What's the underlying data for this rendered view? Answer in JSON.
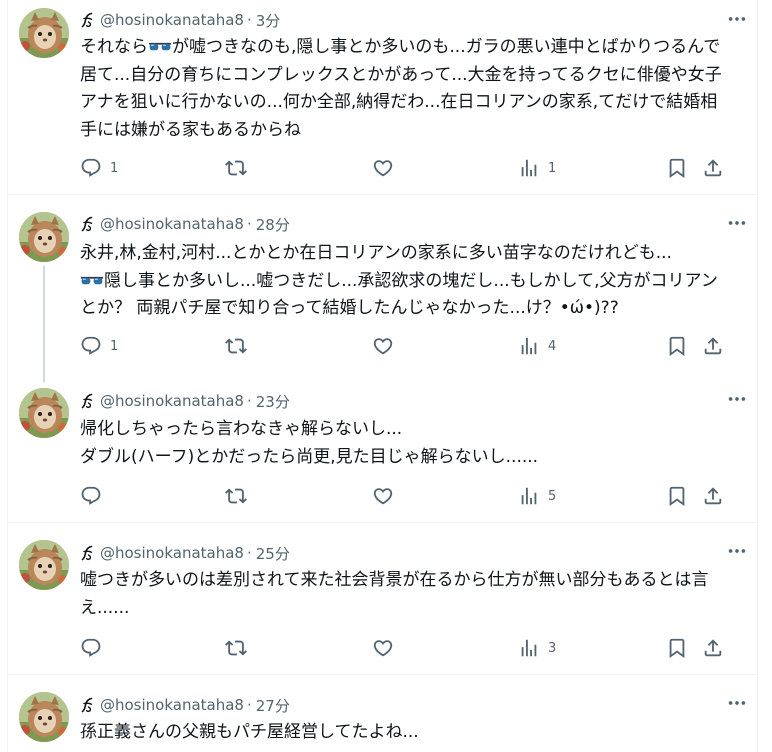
{
  "tweets": [
    {
      "handle": "@hosinokanataha8",
      "time": "3分",
      "text_pre": "それなら",
      "text_post": "が嘘つきなのも,隠し事とか多いのも...ガラの悪い連中とばかりつるんで居て...自分の育ちにコンプレックスとかがあって...大金を持ってるクセに俳優や女子アナを狙いに行かないの...何か全部,納得だわ...在日コリアンの家系,てだけで結婚相手には嫌がる家もあるからね",
      "replies": "1",
      "retweets": "",
      "likes": "",
      "views": "1"
    },
    {
      "handle": "@hosinokanataha8",
      "time": "28分",
      "text_pre": "永井,林,金村,河村...とかとか在日コリアンの家系に多い苗字なのだけれども...\n",
      "text_post": "隠し事とか多いし...嘘つきだし...承認欲求の塊だし...もしかして,父方がコリアンとか？ 両親パチ屋で知り合って結婚したんじゃなかった...け？•ώ•)??",
      "replies": "1",
      "retweets": "",
      "likes": "",
      "views": "4"
    },
    {
      "handle": "@hosinokanataha8",
      "time": "23分",
      "text": "帰化しちゃったら言わなきゃ解らないし...\nダブル(ハーフ)とかだったら尚更,見た目じゃ解らないし......",
      "replies": "",
      "retweets": "",
      "likes": "",
      "views": "5"
    },
    {
      "handle": "@hosinokanataha8",
      "time": "25分",
      "text": "嘘つきが多いのは差別されて来た社会背景が在るから仕方が無い部分もあるとは言え......",
      "replies": "",
      "retweets": "",
      "likes": "",
      "views": "3"
    },
    {
      "handle": "@hosinokanataha8",
      "time": "27分",
      "text": "孫正義さんの父親もパチ屋経営してたよね...",
      "replies": "",
      "retweets": "",
      "likes": "",
      "views": ""
    }
  ],
  "colors": {
    "text": "#0f1419",
    "secondary": "#536471",
    "border": "#eff3f4",
    "thread_line": "#cfd9de"
  },
  "icons": [
    "reply-icon",
    "retweet-icon",
    "like-icon",
    "views-icon",
    "bookmark-icon",
    "share-icon",
    "more-icon",
    "verified-mark-icon"
  ]
}
